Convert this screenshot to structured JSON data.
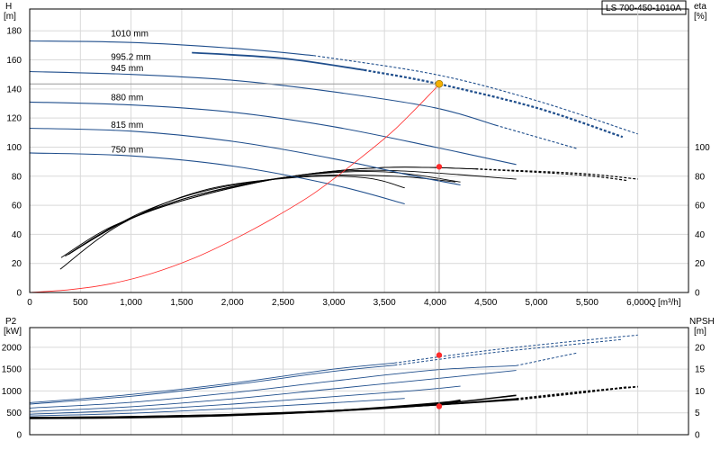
{
  "title": "LS 700-450-1010A",
  "colors": {
    "blue": "#1f4e8c",
    "black": "#000000",
    "red": "#ff2a2a",
    "grid": "#d9d9d9",
    "op": "#f5b000"
  },
  "chart_data": [
    {
      "type": "line",
      "name": "head",
      "y_title": "H",
      "y_unit": "[m]",
      "y2_title": "eta",
      "y2_unit": "[%]",
      "x_title": "Q",
      "x_unit": "[m³/h]",
      "xlim": [
        0,
        6500
      ],
      "ylim": [
        0,
        195
      ],
      "y2lim": [
        0,
        195
      ],
      "x_ticks": [
        0,
        500,
        1000,
        1500,
        2000,
        2500,
        3000,
        3500,
        4000,
        4500,
        5000,
        5500,
        6000
      ],
      "x_tick_labels": [
        "0",
        "500",
        "1,000",
        "1,500",
        "2,000",
        "2,500",
        "3,000",
        "3,500",
        "4,000",
        "4,500",
        "5,000",
        "5,500",
        "6,000"
      ],
      "y_ticks": [
        0,
        20,
        40,
        60,
        80,
        100,
        120,
        140,
        160,
        180
      ],
      "y2_ticks": [
        0,
        20,
        40,
        60,
        80,
        100
      ],
      "grid": true,
      "head_curves": [
        {
          "label": "1010 mm",
          "solid": [
            [
              0,
              173
            ],
            [
              1000,
              172
            ],
            [
              2000,
              168
            ],
            [
              2800,
              163
            ]
          ],
          "dashed": [
            [
              2800,
              163
            ],
            [
              4000,
              150
            ],
            [
              5000,
              132
            ],
            [
              6000,
              109
            ]
          ]
        },
        {
          "label": "995.2 mm",
          "solid": [
            [
              1600,
              165
            ],
            [
              2500,
              161
            ],
            [
              3300,
              153
            ]
          ],
          "dashed": [
            [
              3300,
              153
            ],
            [
              4000,
              144
            ],
            [
              5000,
              127
            ],
            [
              5850,
              107
            ]
          ]
        },
        {
          "label": "945 mm",
          "solid": [
            [
              0,
              152
            ],
            [
              1000,
              150
            ],
            [
              2000,
              146
            ],
            [
              3000,
              138
            ],
            [
              4000,
              127
            ],
            [
              4600,
              115
            ]
          ],
          "dashed": [
            [
              4600,
              115
            ],
            [
              5400,
              99
            ]
          ]
        },
        {
          "label": "880 mm",
          "solid": [
            [
              0,
              131
            ],
            [
              1000,
              129
            ],
            [
              2000,
              124
            ],
            [
              3000,
              114
            ],
            [
              4000,
              100
            ],
            [
              4800,
              88
            ]
          ],
          "dashed": []
        },
        {
          "label": "815 mm",
          "solid": [
            [
              0,
              113
            ],
            [
              1000,
              111
            ],
            [
              2000,
              104
            ],
            [
              3000,
              92
            ],
            [
              3800,
              80
            ],
            [
              4250,
              74
            ]
          ],
          "dashed": []
        },
        {
          "label": "750 mm",
          "solid": [
            [
              0,
              96
            ],
            [
              1000,
              94
            ],
            [
              2000,
              87
            ],
            [
              3000,
              74
            ],
            [
              3700,
              61
            ]
          ],
          "dashed": []
        }
      ],
      "efficiency_curves": [
        {
          "solid": [
            [
              310,
              24
            ],
            [
              800,
              45
            ],
            [
              1500,
              63
            ],
            [
              2500,
              79
            ],
            [
              3500,
              86
            ],
            [
              4400,
              85
            ]
          ],
          "dashed": [
            [
              4400,
              85
            ],
            [
              5400,
              82
            ],
            [
              6000,
              78
            ]
          ]
        },
        {
          "solid": [
            [
              350,
              25
            ],
            [
              850,
              46
            ],
            [
              1500,
              63
            ],
            [
              2500,
              79
            ],
            [
              3500,
              86
            ],
            [
              4400,
              85
            ]
          ],
          "dashed": [
            [
              4400,
              85
            ],
            [
              5400,
              81
            ],
            [
              5900,
              77
            ]
          ]
        },
        {
          "solid": [
            [
              380,
              26
            ],
            [
              900,
              48
            ],
            [
              1600,
              66
            ],
            [
              2600,
              80
            ],
            [
              3500,
              84
            ],
            [
              4800,
              78
            ]
          ],
          "dashed": []
        },
        {
          "solid": [
            [
              420,
              28
            ],
            [
              1000,
              51
            ],
            [
              1700,
              68
            ],
            [
              2600,
              80
            ],
            [
              3500,
              83
            ],
            [
              4250,
              76
            ]
          ],
          "dashed": []
        },
        {
          "solid": [
            [
              460,
              30
            ],
            [
              1100,
              55
            ],
            [
              1800,
              71
            ],
            [
              2700,
              80
            ],
            [
              3600,
              80
            ],
            [
              4200,
              76
            ]
          ],
          "dashed": []
        },
        {
          "solid": [
            [
              300,
              16
            ],
            [
              900,
              47
            ],
            [
              1700,
              70
            ],
            [
              2600,
              79
            ],
            [
              3300,
              79
            ],
            [
              3700,
              72
            ]
          ],
          "dashed": []
        }
      ],
      "system_curve": [
        [
          0,
          0
        ],
        [
          400,
          2
        ],
        [
          800,
          6
        ],
        [
          1200,
          13
        ],
        [
          1600,
          23
        ],
        [
          2000,
          36
        ],
        [
          2400,
          51
        ],
        [
          2800,
          68
        ],
        [
          3200,
          89
        ],
        [
          3600,
          112
        ],
        [
          4040,
          143
        ]
      ],
      "operating_point": {
        "q": 4040,
        "h": 143.5,
        "eta": 86.5
      }
    },
    {
      "type": "line",
      "name": "power_npsh",
      "y_title": "P2",
      "y_unit": "[kW]",
      "y2_title": "NPSH",
      "y2_unit": "[m]",
      "xlim": [
        0,
        6500
      ],
      "ylim": [
        0,
        2450
      ],
      "y2lim": [
        0,
        24.5
      ],
      "y_ticks": [
        0,
        500,
        1000,
        1500,
        2000
      ],
      "y2_ticks": [
        0,
        5,
        10,
        15,
        20
      ],
      "grid": true,
      "power_curves": [
        {
          "solid": [
            [
              0,
              730
            ],
            [
              1000,
              920
            ],
            [
              2000,
              1180
            ],
            [
              3000,
              1500
            ],
            [
              3600,
              1640
            ]
          ],
          "dashed": [
            [
              3600,
              1640
            ],
            [
              4500,
              1920
            ],
            [
              5300,
              2120
            ],
            [
              6000,
              2280
            ]
          ]
        },
        {
          "solid": [
            [
              0,
              700
            ],
            [
              1000,
              880
            ],
            [
              2000,
              1140
            ],
            [
              3000,
              1450
            ],
            [
              3600,
              1590
            ]
          ],
          "dashed": [
            [
              3600,
              1590
            ],
            [
              4500,
              1860
            ],
            [
              5300,
              2050
            ],
            [
              5850,
              2180
            ]
          ]
        },
        {
          "solid": [
            [
              0,
              610
            ],
            [
              1000,
              740
            ],
            [
              2000,
              960
            ],
            [
              3000,
              1230
            ],
            [
              4000,
              1480
            ],
            [
              4800,
              1580
            ]
          ],
          "dashed": [
            [
              4800,
              1580
            ],
            [
              5400,
              1870
            ]
          ]
        },
        {
          "solid": [
            [
              0,
              530
            ],
            [
              1000,
              640
            ],
            [
              2000,
              820
            ],
            [
              3000,
              1050
            ],
            [
              4000,
              1280
            ],
            [
              4800,
              1470
            ]
          ],
          "dashed": []
        },
        {
          "solid": [
            [
              0,
              470
            ],
            [
              1000,
              560
            ],
            [
              2000,
              700
            ],
            [
              3000,
              870
            ],
            [
              3800,
              1010
            ],
            [
              4250,
              1110
            ]
          ],
          "dashed": []
        },
        {
          "solid": [
            [
              0,
              430
            ],
            [
              1000,
              490
            ],
            [
              2000,
              600
            ],
            [
              3000,
              730
            ],
            [
              3700,
              830
            ]
          ],
          "dashed": []
        }
      ],
      "npsh_curves": [
        {
          "solid": [
            [
              0,
              3.9
            ],
            [
              1000,
              4.1
            ],
            [
              2000,
              4.6
            ],
            [
              3000,
              5.5
            ],
            [
              4000,
              6.8
            ],
            [
              4800,
              8.2
            ]
          ],
          "dashed": [
            [
              4800,
              8.2
            ],
            [
              5400,
              9.7
            ],
            [
              6000,
              11.0
            ]
          ]
        },
        {
          "solid": [
            [
              0,
              3.8
            ],
            [
              1000,
              4.0
            ],
            [
              2000,
              4.5
            ],
            [
              3000,
              5.4
            ],
            [
              4000,
              6.8
            ],
            [
              4800,
              8.0
            ]
          ],
          "dashed": [
            [
              4800,
              8.0
            ],
            [
              5400,
              9.5
            ],
            [
              5900,
              10.9
            ]
          ]
        },
        {
          "solid": [
            [
              0,
              3.9
            ],
            [
              1000,
              4.1
            ],
            [
              2000,
              4.6
            ],
            [
              3000,
              5.5
            ],
            [
              4000,
              7.0
            ],
            [
              4800,
              9.0
            ]
          ],
          "dashed": []
        },
        {
          "solid": [
            [
              0,
              3.8
            ],
            [
              1000,
              4.0
            ],
            [
              2000,
              4.5
            ],
            [
              3000,
              5.5
            ],
            [
              4000,
              7.2
            ],
            [
              4250,
              7.9
            ]
          ],
          "dashed": []
        },
        {
          "solid": [
            [
              0,
              3.7
            ],
            [
              1000,
              3.9
            ],
            [
              2000,
              4.4
            ],
            [
              3000,
              5.4
            ],
            [
              3700,
              6.5
            ]
          ],
          "dashed": []
        }
      ],
      "operating_point_power": {
        "q": 4040,
        "p": 1820
      },
      "operating_point_npsh": {
        "q": 4040,
        "npsh": 6.5
      }
    }
  ]
}
